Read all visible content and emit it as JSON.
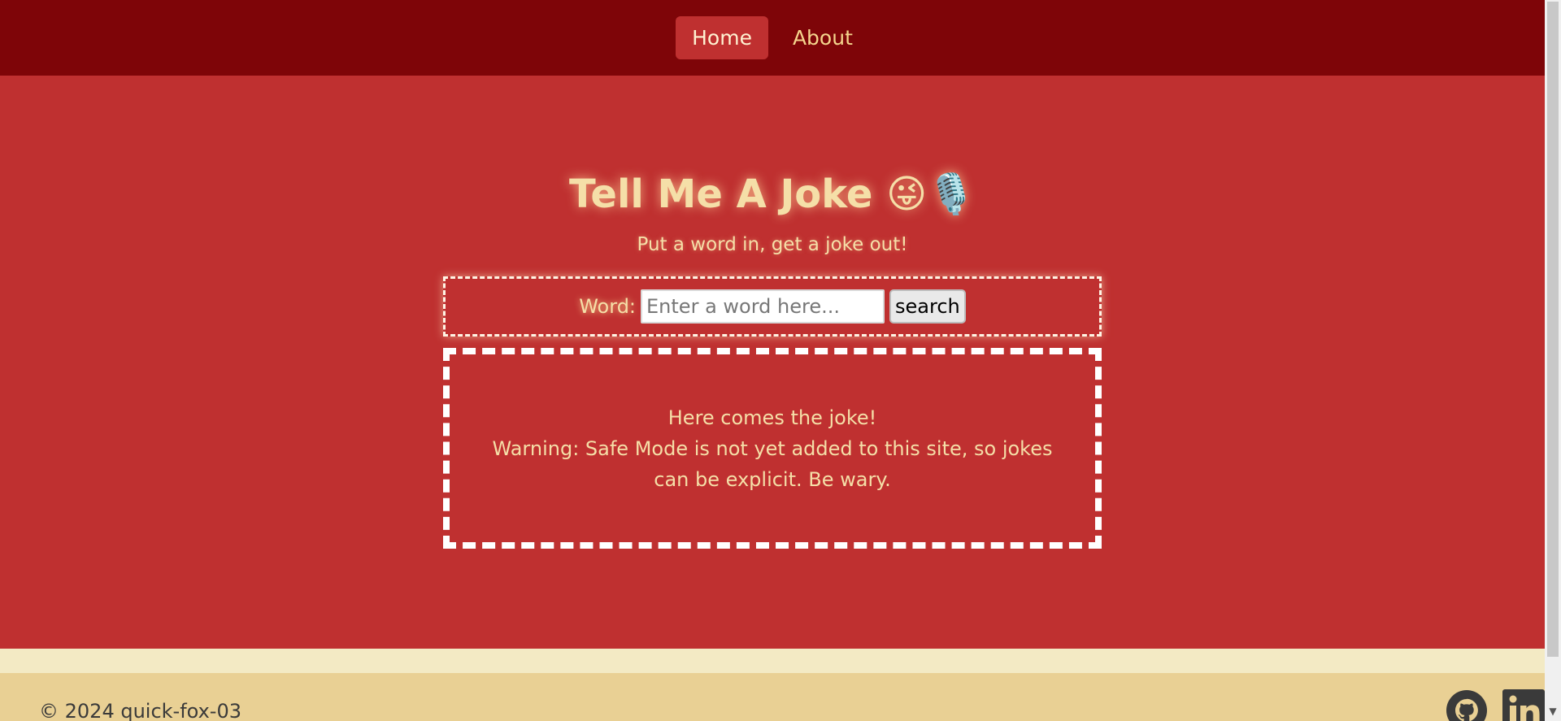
{
  "nav": {
    "items": [
      {
        "label": "Home",
        "active": true
      },
      {
        "label": "About",
        "active": false
      }
    ]
  },
  "hero": {
    "title": "Tell Me A Joke 😜🎙️",
    "subtitle": "Put a word in, get a joke out!"
  },
  "search": {
    "label": "Word:",
    "placeholder": "Enter a word here...",
    "value": "",
    "button_label": "search"
  },
  "joke": {
    "line1": "Here comes the joke!",
    "line2": "Warning: Safe Mode is not yet added to this site, so jokes can be explicit. Be wary."
  },
  "footer": {
    "copyright": "© 2024 quick-fox-03",
    "icons": [
      "github-icon",
      "linkedin-icon"
    ]
  },
  "colors": {
    "nav_bg": "#7e0508",
    "main_bg": "#bf3030",
    "accent_text": "#f5dfa8",
    "footer_bg": "#e9d094",
    "footer_strip": "#f3eac4"
  }
}
